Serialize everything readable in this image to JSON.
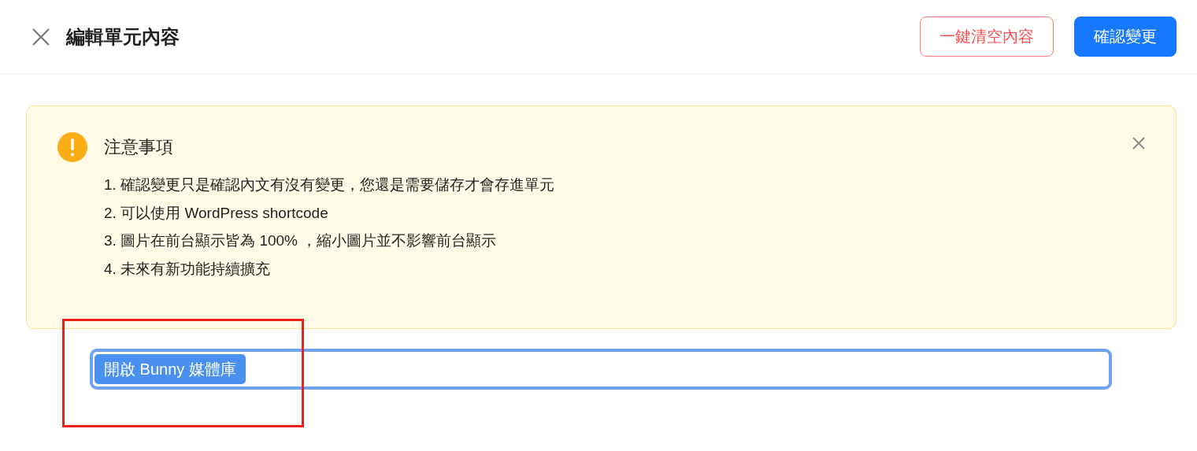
{
  "header": {
    "title": "編輯單元內容",
    "buttons": [
      {
        "label": "一鍵清空內容",
        "kind": "danger"
      },
      {
        "label": "確認變更",
        "kind": "primary"
      }
    ]
  },
  "alert": {
    "title": "注意事項",
    "items": [
      "1. 確認變更只是確認內文有沒有變更，您還是需要儲存才會存進單元",
      "2. 可以使用 WordPress shortcode",
      "3. 圖片在前台顯示皆為 100% ，縮小圖片並不影響前台顯示",
      "4. 未來有新功能持續擴充"
    ]
  },
  "editor": {
    "focused": true,
    "button": "開啟 Bunny 媒體庫",
    "highlighted": true
  }
}
